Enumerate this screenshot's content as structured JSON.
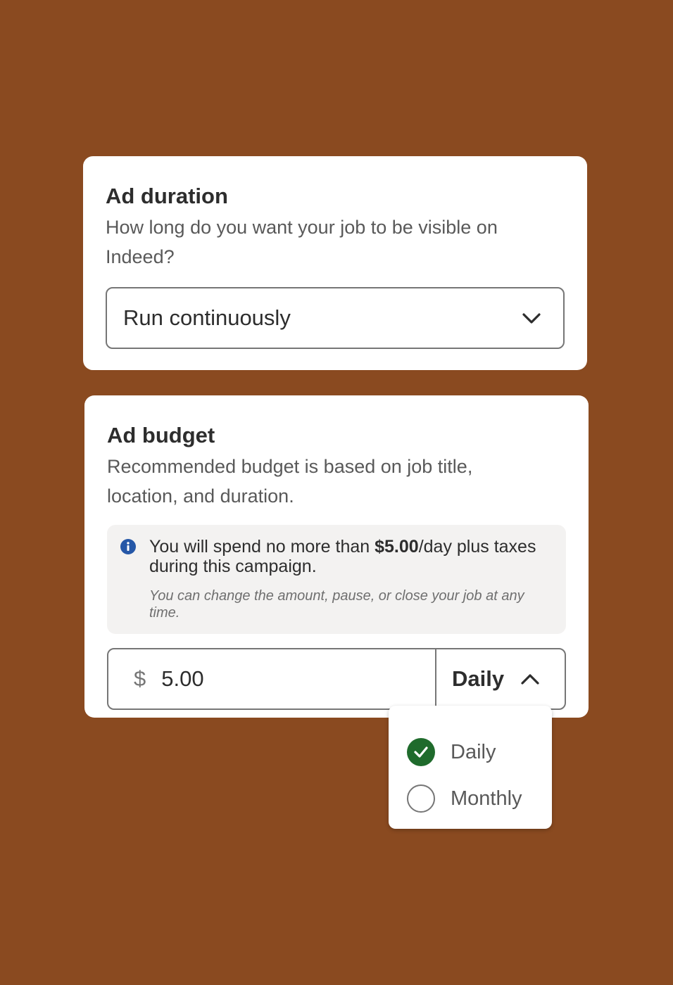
{
  "duration": {
    "title": "Ad duration",
    "description": "How long do you want your job to be visible on Indeed?",
    "select_value": "Run continuously",
    "select_icon": "chevron-down-icon"
  },
  "budget": {
    "title": "Ad budget",
    "description": "Recommended budget is based on job title, location, and duration.",
    "info": {
      "icon": "info-icon",
      "text_before": "You will spend no more than ",
      "amount": "$5.00",
      "text_after": "/day plus taxes during this campaign.",
      "note": "You can change the amount, pause, or close your job at any time."
    },
    "currency_symbol": "$",
    "amount_value": "5.00",
    "period_value": "Daily",
    "period_icon": "chevron-up-icon"
  },
  "period_dropdown": {
    "options": [
      {
        "label": "Daily",
        "selected": true
      },
      {
        "label": "Monthly",
        "selected": false
      }
    ]
  },
  "colors": {
    "background": "#8a4a20",
    "card": "#ffffff",
    "info_icon": "#2557a7",
    "selected_radio": "#1f6b2c",
    "border": "#767676"
  }
}
